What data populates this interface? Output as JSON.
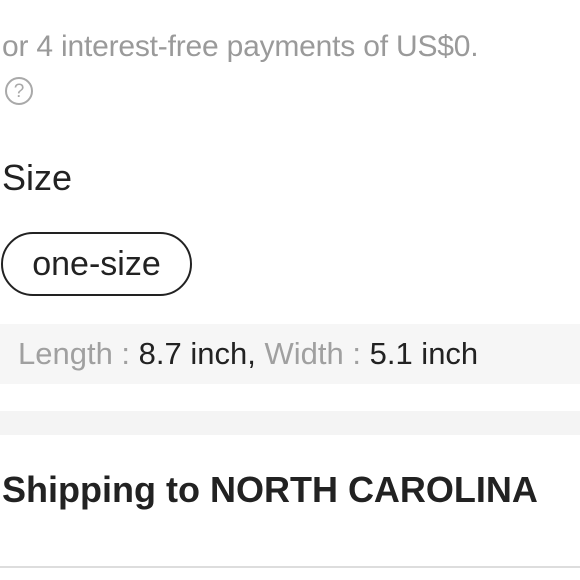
{
  "payment": {
    "installment_text": "or 4 interest-free payments of US$0.",
    "help_icon": "?"
  },
  "size": {
    "label": "Size",
    "options": [
      "one-size"
    ],
    "selected": "one-size"
  },
  "dimensions": {
    "length_label": "Length :",
    "length_value": "8.7 inch,",
    "width_label": "Width :",
    "width_value": "5.1 inch"
  },
  "shipping": {
    "title": "Shipping to NORTH CAROLINA"
  }
}
